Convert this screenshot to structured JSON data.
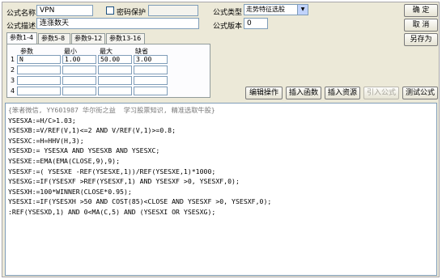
{
  "form": {
    "name_label": "公式名称",
    "name_value": "VPN",
    "password_label": "密码保护",
    "desc_label": "公式描述",
    "desc_value": "连涨数天",
    "type_label": "公式类型",
    "type_value": "走势特征选股",
    "version_label": "公式版本",
    "version_value": "0"
  },
  "buttons": {
    "ok": "确 定",
    "cancel": "取 消",
    "save_as": "另存为",
    "edit_op": "编辑操作",
    "insert_func": "插入函数",
    "insert_res": "插入资源",
    "import_formula": "引入公式",
    "test_formula": "测试公式"
  },
  "tabs": [
    "参数1-4",
    "参数5-8",
    "参数9-12",
    "参数13-16"
  ],
  "params": {
    "headers": [
      "参数",
      "最小",
      "最大",
      "缺省"
    ],
    "rows": [
      {
        "num": "1",
        "name": "N",
        "min": "1.00",
        "max": "50.00",
        "default": "3.00"
      },
      {
        "num": "2",
        "name": "",
        "min": "",
        "max": "",
        "default": ""
      },
      {
        "num": "3",
        "name": "",
        "min": "",
        "max": "",
        "default": ""
      },
      {
        "num": "4",
        "name": "",
        "min": "",
        "max": "",
        "default": ""
      }
    ]
  },
  "code": {
    "comment": "{笨者微信, YY601987 华尔街之益  学习股票知识, 精准选取牛股}",
    "lines": [
      "YSESXA:=H/C>1.03;",
      "YSESXB:=V/REF(V,1)<=2 AND V/REF(V,1)>=0.8;",
      "YSESXC:=H=HHV(H,3);",
      "YSESXD:= YSESXA AND YSESXB AND YSESXC;",
      "YSESXE:=EMA(EMA(CLOSE,9),9);",
      "YSESXF:=( YSESXE -REF(YSESXE,1))/REF(YSESXE,1)*1000;",
      "YSESXG:=IF(YSESXF >REF(YSESXF,1) AND YSESXF >0, YSESXF,0);",
      "YSESXH:=100*WINNER(CLOSE*0.95);",
      "YSESXI:=IF(YSESXH >50 AND COST(85)<CLOSE AND YSESXF >0, YSESXF,0);",
      ":REF(YSESXD,1) AND 0<MA(C,5) AND (YSESXI OR YSESXG);"
    ]
  }
}
